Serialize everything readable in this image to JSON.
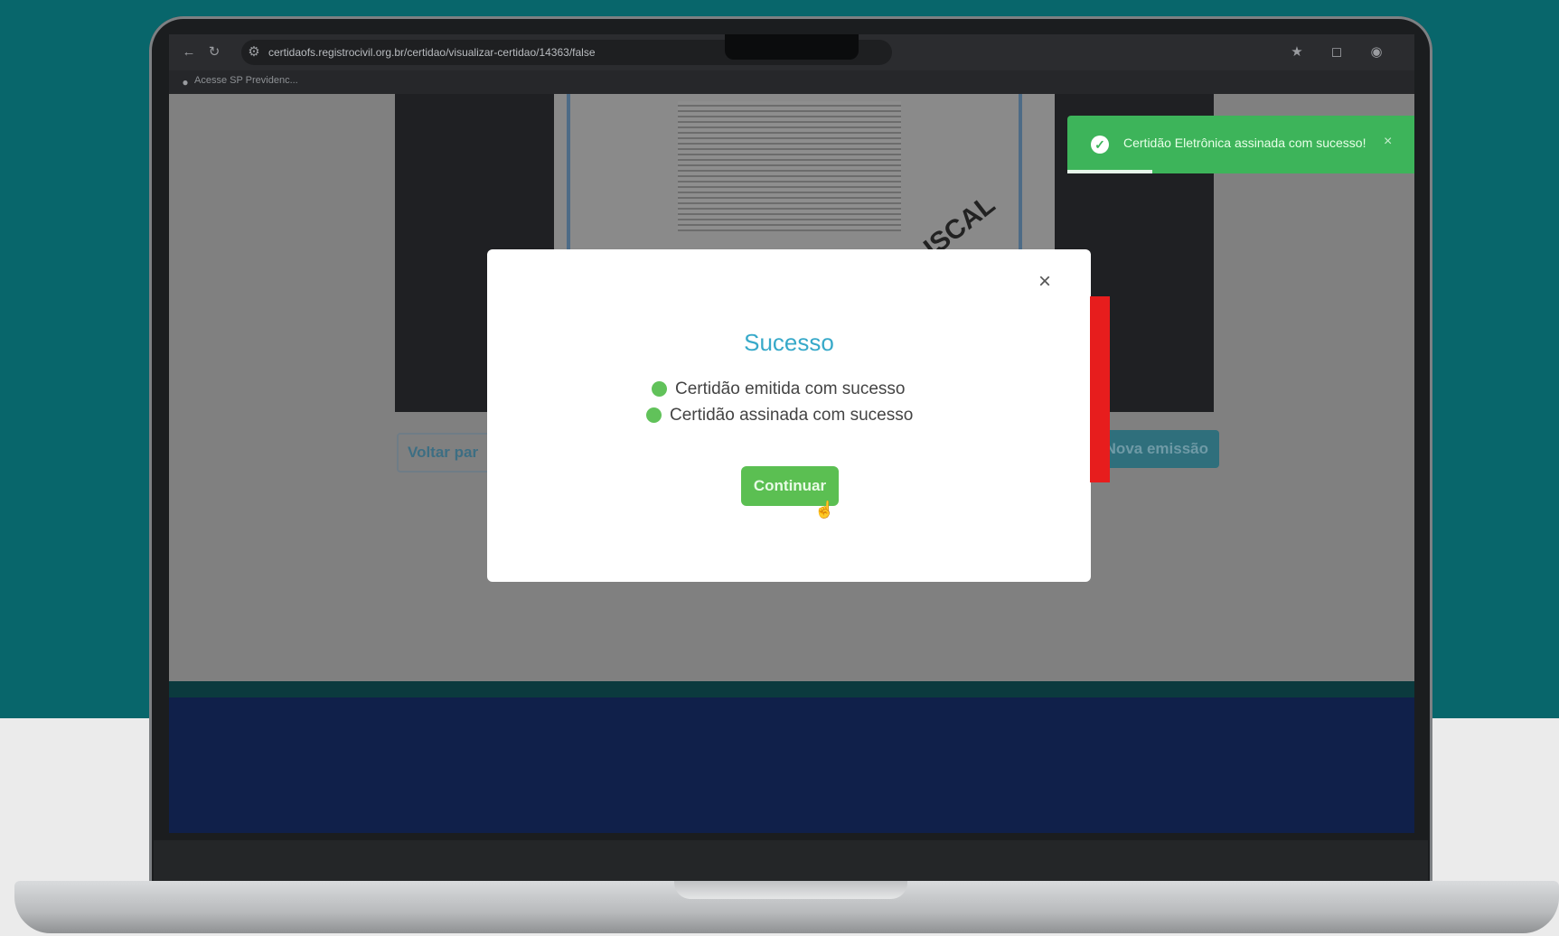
{
  "browser": {
    "url": "certidaofs.registrocivil.org.br/certidao/visualizar-certidao/14363/false",
    "bookmark": "Acesse SP Previdenc...",
    "icons": [
      "back-icon",
      "reload-icon",
      "site-info-icon",
      "star-icon",
      "extension-icon",
      "profile-icon"
    ]
  },
  "toast": {
    "message": "Certidão Eletrônica assinada com sucesso!",
    "close": "×"
  },
  "document": {
    "watermark": "ISCAL"
  },
  "page_buttons": {
    "back": "Voltar par",
    "new_issue": "Nova emissão"
  },
  "modal": {
    "close": "×",
    "title": "Sucesso",
    "items": [
      "Certidão emitida com sucesso",
      "Certidão assinada com sucesso"
    ],
    "continue": "Continuar"
  },
  "colors": {
    "background_teal": "#08666b",
    "modal_title": "#37a9c9",
    "success_green": "#5bbf52",
    "toast_green": "#3db45a",
    "accent_red": "#e71d1d"
  }
}
